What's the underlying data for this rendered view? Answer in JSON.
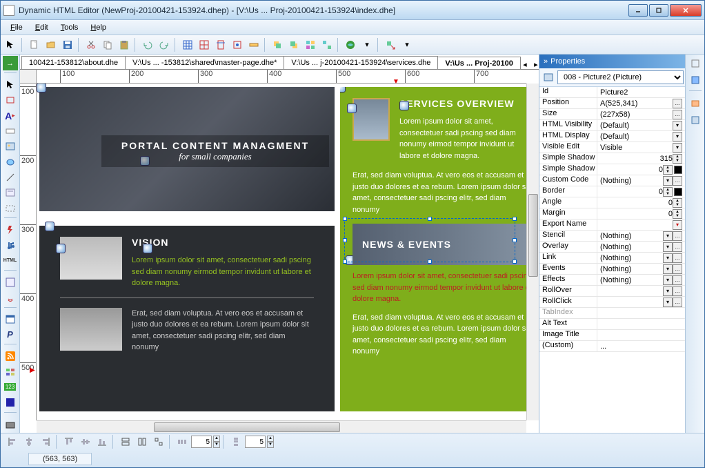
{
  "window": {
    "title": "Dynamic HTML Editor (NewProj-20100421-153924.dhep) - [V:\\Us ... Proj-20100421-153924\\index.dhe]"
  },
  "menubar": {
    "items": [
      "File",
      "Edit",
      "Tools",
      "Help"
    ]
  },
  "tabs": {
    "items": [
      "100421-153812\\about.dhe",
      "V:\\Us ... -153812\\shared\\master-page.dhe*",
      "V:\\Us ... j-20100421-153924\\services.dhe",
      "V:\\Us ... Proj-20100"
    ],
    "active": 3
  },
  "ruler_h": [
    "100",
    "200",
    "300",
    "400",
    "500",
    "600",
    "700"
  ],
  "ruler_v": [
    "100",
    "200",
    "300",
    "400",
    "500"
  ],
  "canvas": {
    "hero_title": "PORTAL CONTENT MANAGMENT",
    "hero_sub": "for small companies",
    "vision_h": "VISION",
    "vision_body1": "Lorem ipsum dolor sit amet, consectetuer sadi pscing sed diam nonumy eirmod tempor invidunt ut labore et dolore magna.",
    "vision_body2": "Erat, sed diam voluptua. At vero eos et accusam et justo duo dolores et ea rebum. Lorem ipsum dolor sit amet, consectetuer sadi pscing elitr, sed diam nonumy",
    "svc_h": "SERVICES OVERVIEW",
    "svc_body1": "Lorem ipsum dolor sit amet, consectetuer sadi pscing sed diam nonumy eirmod tempor invidunt ut labore et dolore magna.",
    "svc_body2": "Erat, sed diam voluptua. At vero eos et accusam et justo duo dolores et ea rebum. Lorem ipsum dolor sit amet, consectetuer sadi pscing elitr, sed diam nonumy",
    "news_h": "NEWS & EVENTS",
    "news_body1": "Lorem ipsum dolor sit amet, consectetuer sadi pscing sed diam nonumy eirmod tempor invidunt ut labore et dolore magna.",
    "news_body2": "Erat, sed diam voluptua. At vero eos et accusam et justo duo dolores et ea rebum. Lorem ipsum dolor sit amet, consectetuer sadi pscing elitr, sed diam nonumy"
  },
  "properties_panel": {
    "title": "Properties",
    "object_selector": "008 - Picture2 (Picture)",
    "props": [
      {
        "name": "Id",
        "value": "Picture2",
        "ctrl": ""
      },
      {
        "name": "Position",
        "value": "A(525,341)",
        "ctrl": "..."
      },
      {
        "name": "Size",
        "value": "(227x58)",
        "ctrl": "..."
      },
      {
        "name": "HTML Visibility",
        "value": "(Default)",
        "ctrl": "dd"
      },
      {
        "name": "HTML Display",
        "value": "(Default)",
        "ctrl": "dd"
      },
      {
        "name": "Visible Edit",
        "value": "Visible",
        "ctrl": "dd"
      },
      {
        "name": "Simple Shadow",
        "value": "315",
        "ctrl": "spin"
      },
      {
        "name": "Simple Shadow",
        "value": "0",
        "ctrl": "spin-swatch",
        "swatch": "#000"
      },
      {
        "name": "Custom Code",
        "value": "(Nothing)",
        "ctrl": "dd..."
      },
      {
        "name": "Border",
        "value": "0",
        "ctrl": "spin-swatch",
        "swatch": "#000"
      },
      {
        "name": "Angle",
        "value": "0",
        "ctrl": "spin"
      },
      {
        "name": "Margin",
        "value": "0",
        "ctrl": "spin"
      },
      {
        "name": "Export Name",
        "value": "",
        "ctrl": "red"
      },
      {
        "name": "Stencil",
        "value": "(Nothing)",
        "ctrl": "dd..."
      },
      {
        "name": "Overlay",
        "value": "(Nothing)",
        "ctrl": "dd..."
      },
      {
        "name": "Link",
        "value": "(Nothing)",
        "ctrl": "dd..."
      },
      {
        "name": "Events",
        "value": "(Nothing)",
        "ctrl": "dd..."
      },
      {
        "name": "Effects",
        "value": "(Nothing)",
        "ctrl": "dd..."
      },
      {
        "name": "RollOver",
        "value": "",
        "ctrl": "dd..."
      },
      {
        "name": "RollClick",
        "value": "",
        "ctrl": "dd..."
      },
      {
        "name": "TabIndex",
        "value": "",
        "ctrl": "",
        "disabled": true
      },
      {
        "name": "Alt Text",
        "value": "",
        "ctrl": ""
      },
      {
        "name": "Image Title",
        "value": "",
        "ctrl": ""
      },
      {
        "name": "(Custom)",
        "value": "...",
        "ctrl": ""
      }
    ]
  },
  "align_inputs": {
    "v1": "5",
    "v2": "5"
  },
  "status": {
    "coords": "(563, 563)"
  }
}
